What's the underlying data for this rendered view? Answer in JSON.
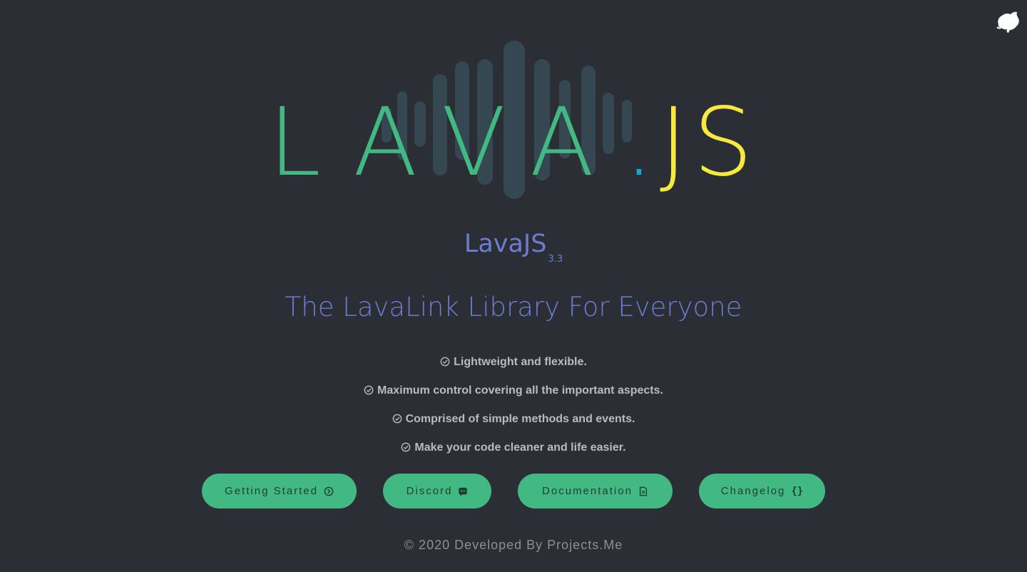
{
  "logo": {
    "text_lava": "LAVA",
    "text_dot": ".",
    "text_js": "JS"
  },
  "header": {
    "name": "LavaJS",
    "version": "3.3",
    "tagline": "The LavaLink Library For Everyone"
  },
  "features": [
    "Lightweight and flexible.",
    "Maximum control covering all the important aspects.",
    "Comprised of simple methods and events.",
    "Make your code cleaner and life easier."
  ],
  "buttons": {
    "getting_started": "Getting Started",
    "discord": "Discord",
    "documentation": "Documentation",
    "changelog": "Changelog",
    "changelog_icon": "{}"
  },
  "footer": {
    "text": "© 2020 Developed By Projects.Me"
  },
  "icons": {
    "corner": "github-octocat-icon",
    "features": "check-circle-icon",
    "getting_started": "chevron-right-circle-icon",
    "discord": "discord-icon",
    "documentation": "document-icon",
    "changelog": "curly-braces-icon"
  },
  "colors": {
    "background": "#2b2e35",
    "green": "#42b983",
    "yellow": "#f8e93e",
    "dot_blue": "#0ca8d8",
    "indigo": "#6c7dd0",
    "wave_bars": "#354750"
  }
}
